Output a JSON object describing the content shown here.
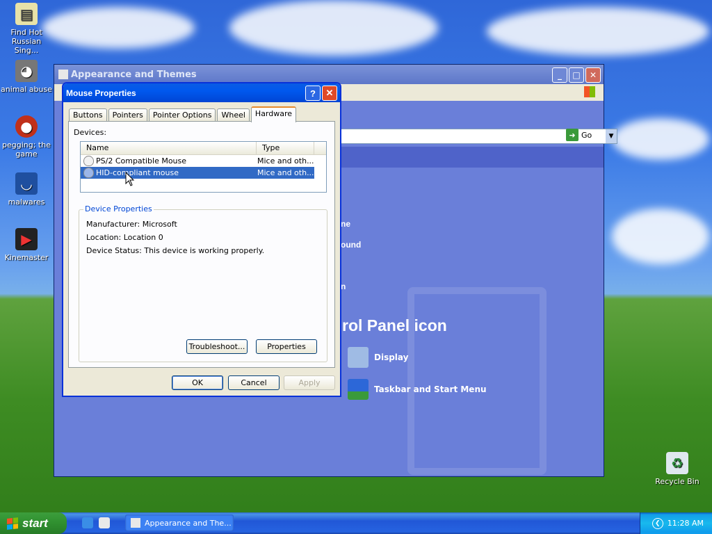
{
  "desktop": {
    "icons": [
      {
        "label": "Find Hot Russian Sing...",
        "icon": "document-icon"
      },
      {
        "label": "animal abuse",
        "icon": "raccoon-icon"
      },
      {
        "label": "pegging; the game",
        "icon": "ball-icon"
      },
      {
        "label": "malwares",
        "icon": "app-icon"
      },
      {
        "label": "Kinemaster",
        "icon": "clapper-icon"
      },
      {
        "label": "Recycle Bin",
        "icon": "recycle-bin-icon"
      }
    ]
  },
  "background_window": {
    "title": "Appearance and Themes",
    "go_label": "Go",
    "partial_texts": {
      "t1": "ne",
      "t2": "ound",
      "t3": "n",
      "heading": "rol Panel icon"
    },
    "tasks": [
      {
        "label": "Display",
        "icon": "display-icon"
      },
      {
        "label": "Taskbar and Start Menu",
        "icon": "taskbar-icon"
      }
    ]
  },
  "dialog": {
    "title": "Mouse Properties",
    "help_glyph": "?",
    "close_glyph": "✕",
    "tabs": [
      "Buttons",
      "Pointers",
      "Pointer Options",
      "Wheel",
      "Hardware"
    ],
    "active_tab": "Hardware",
    "devices_label": "Devices:",
    "columns": [
      "Name",
      "Type"
    ],
    "devices": [
      {
        "name": "PS/2 Compatible Mouse",
        "type": "Mice and oth...",
        "selected": false
      },
      {
        "name": "HID-compliant mouse",
        "type": "Mice and oth...",
        "selected": true
      }
    ],
    "device_properties": {
      "label": "Device Properties",
      "manufacturer": "Manufacturer: Microsoft",
      "location": "Location: Location 0",
      "status": "Device Status: This device is working properly."
    },
    "buttons": {
      "troubleshoot": "Troubleshoot...",
      "properties": "Properties",
      "ok": "OK",
      "cancel": "Cancel",
      "apply": "Apply"
    }
  },
  "taskbar": {
    "start_label": "start",
    "task_button": "Appearance and The...",
    "clock": "11:28 AM"
  },
  "colors": {
    "selection": "#316ac5",
    "title_blue": "#0058ee",
    "tab_highlight": "#e68b2c"
  }
}
